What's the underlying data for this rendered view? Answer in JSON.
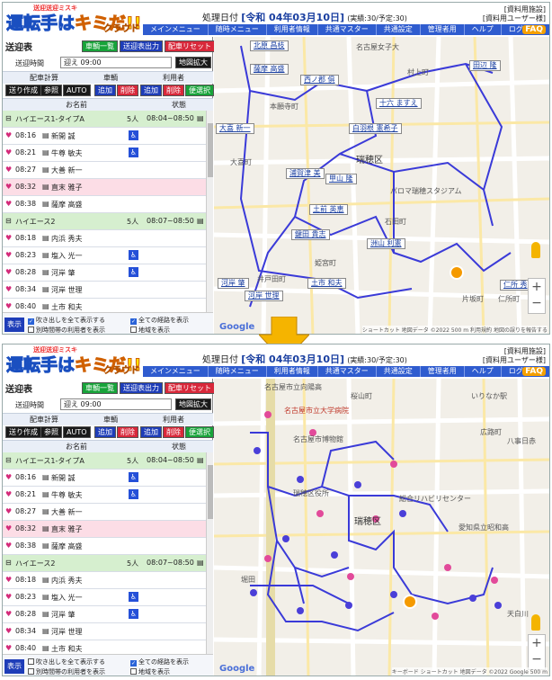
{
  "app": {
    "logo_tag": "送迎送迎ミスキ",
    "logo_main_a": "運転手は",
    "logo_main_b": "キミ",
    "logo_main_c": "だ!!",
    "logo_cloud": "クラウド",
    "processing_label": "処理日付",
    "processing_date": "[令和 04年03月10日]",
    "processing_counts": "(実績:30/予定:30)",
    "facility": "[資料用施設]",
    "user": "[資料用ユーザー様]",
    "faq": "FAQ"
  },
  "menu": [
    "メインメニュー",
    "随時メニュー",
    "利用者情報",
    "共通マスター",
    "共通設定",
    "管理者用",
    "ヘルプ",
    "ログアウト"
  ],
  "panel": {
    "title": "送迎表",
    "vehicle_list_btn": "車輌一覧",
    "output_btn": "送迎表出力",
    "reset_btn": "配車リセット",
    "time_label": "送迎時間",
    "time_value": "迎え 09:00",
    "map_zoom_btn": "地図拡大",
    "calc_label": "配車計算",
    "vehicle_label": "車輌",
    "user_label": "利用者",
    "send_btn": "送り作成",
    "ref_btn": "参照",
    "auto_btn": "AUTO",
    "add_btn": "追加",
    "del_btn": "削除",
    "add_btn2": "追加",
    "del_btn2": "削除",
    "convenient_btn": "便選択",
    "col_name": "お名前",
    "col_status": "状態"
  },
  "rows": [
    {
      "kind": "vehicle",
      "name": "ハイエース1-タイプA",
      "count": "5人",
      "time": "08:04~08:50"
    },
    {
      "kind": "user",
      "time": "08:16",
      "name": "新開 誠",
      "wheel": true
    },
    {
      "kind": "user",
      "time": "08:21",
      "name": "牛尊 敏夫",
      "wheel": true
    },
    {
      "kind": "user",
      "time": "08:27",
      "name": "大善 新一",
      "wheel": false
    },
    {
      "kind": "user",
      "time": "08:32",
      "name": "直末 雅子",
      "wheel": false,
      "pink": true
    },
    {
      "kind": "user",
      "time": "08:38",
      "name": "薩摩 高盛",
      "wheel": false
    },
    {
      "kind": "vehicle",
      "name": "ハイエース2",
      "count": "5人",
      "time": "08:07~08:50"
    },
    {
      "kind": "user",
      "time": "08:18",
      "name": "内浜 秀夫",
      "wheel": false
    },
    {
      "kind": "user",
      "time": "08:23",
      "name": "塩入 光一",
      "wheel": true
    },
    {
      "kind": "user",
      "time": "08:28",
      "name": "河岸 肇",
      "wheel": true
    },
    {
      "kind": "user",
      "time": "08:34",
      "name": "河岸 世理",
      "wheel": false
    },
    {
      "kind": "user",
      "time": "08:40",
      "name": "土市 和夫",
      "wheel": false
    }
  ],
  "footer": {
    "display_btn": "表示",
    "chk1": "吹き出しを全て表示する",
    "chk2": "全ての経路を表示",
    "chk3": "別時間帯の利用者を表示",
    "chk4": "地域を表示"
  },
  "map1": {
    "labels": [
      "名古屋女子大",
      "村上町",
      "瑞穂区",
      "パロマ瑞穂スタジアム",
      "本願寺町",
      "大喜町",
      "石田町",
      "姫宮町",
      "片坂町",
      "仁所町",
      "井戸田町",
      "ショートカット",
      "地図データ ©2022",
      "500 m",
      "利用規約",
      "地図の誤りを報告する"
    ],
    "callouts": [
      "北原 昌枝",
      "薩摩 高盛",
      "西ノ郡 俱",
      "田辺 隆",
      "十六 ますえ",
      "大喜 新一",
      "白羽根 憲希子",
      "浦賀津 美",
      "甲山 隆",
      "土前 英恵",
      "鍵田 貴志",
      "洲山 利憲",
      "土市 和夫",
      "河岸 世理",
      "仁所 秀",
      "河岸 肇"
    ]
  },
  "map2": {
    "labels": [
      "名古屋市立向陽高",
      "桜山町",
      "いりなか駅",
      "名古屋市立大学病院",
      "名古屋市博物館",
      "広路町",
      "八事日赤",
      "瑞穂区役所",
      "総合リハビリセンター",
      "瑞穂区",
      "愛知県立昭和高",
      "堀田",
      "天白川",
      "地図データ ©2022 Google",
      "500 m",
      "キーボード ショートカット"
    ]
  },
  "colors": {
    "brand_blue": "#2f5ccf",
    "route": "#3a3ad8",
    "pin_pink": "#e24a9a",
    "green": "#18a33a",
    "red": "#d8283a"
  }
}
